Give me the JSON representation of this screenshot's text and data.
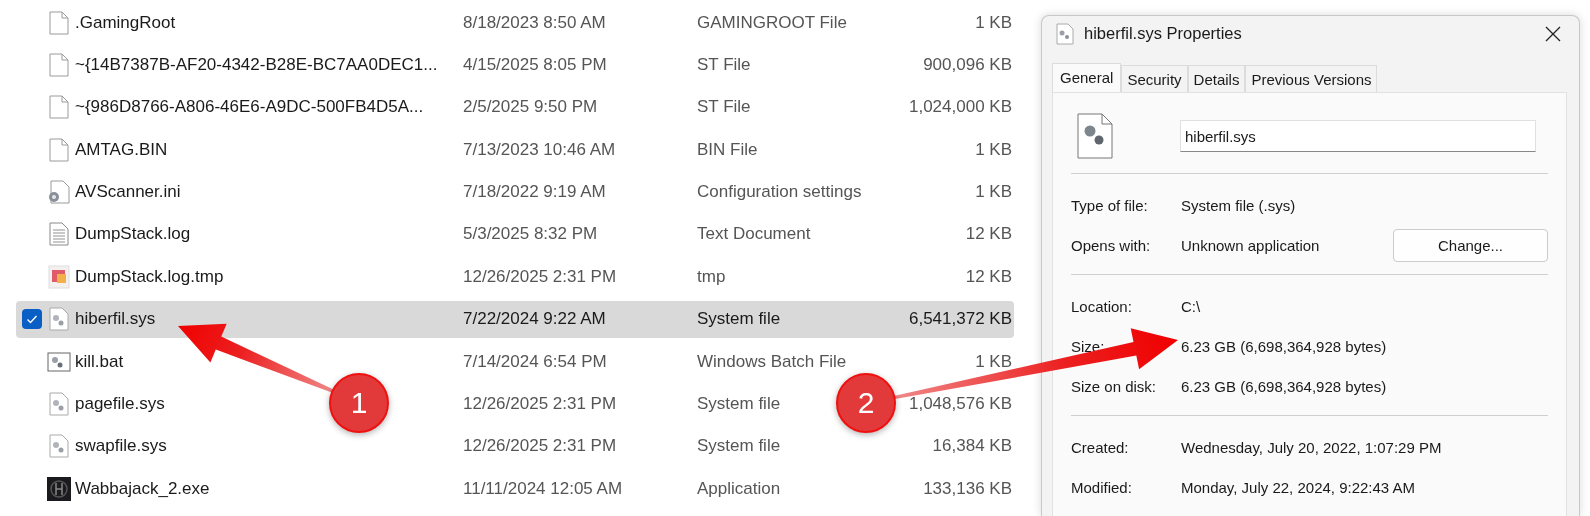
{
  "files": [
    {
      "name": ".GamingRoot",
      "modified": "8/18/2023 8:50 AM",
      "type": "GAMINGROOT File",
      "size": "1 KB",
      "kind": "blank",
      "selected": false
    },
    {
      "name": "~{14B7387B-AF20-4342-B28E-BC7AA0DEC1...",
      "modified": "4/15/2025 8:05 PM",
      "type": "ST File",
      "size": "900,096 KB",
      "kind": "blank",
      "selected": false
    },
    {
      "name": "~{986D8766-A806-46E6-A9DC-500FB4D5A...",
      "modified": "2/5/2025 9:50 PM",
      "type": "ST File",
      "size": "1,024,000 KB",
      "kind": "blank",
      "selected": false
    },
    {
      "name": "AMTAG.BIN",
      "modified": "7/13/2023 10:46 AM",
      "type": "BIN File",
      "size": "1 KB",
      "kind": "blank",
      "selected": false
    },
    {
      "name": "AVScanner.ini",
      "modified": "7/18/2022 9:19 AM",
      "type": "Configuration settings",
      "size": "1 KB",
      "kind": "config",
      "selected": false
    },
    {
      "name": "DumpStack.log",
      "modified": "5/3/2025 8:32 PM",
      "type": "Text Document",
      "size": "12 KB",
      "kind": "text",
      "selected": false
    },
    {
      "name": "DumpStack.log.tmp",
      "modified": "12/26/2025 2:31 PM",
      "type": "tmp",
      "size": "12 KB",
      "kind": "tmp",
      "selected": false
    },
    {
      "name": "hiberfil.sys",
      "modified": "7/22/2024 9:22 AM",
      "type": "System file",
      "size": "6,541,372 KB",
      "kind": "system",
      "selected": true
    },
    {
      "name": "kill.bat",
      "modified": "7/14/2024 6:54 PM",
      "type": "Windows Batch File",
      "size": "1 KB",
      "kind": "batch",
      "selected": false
    },
    {
      "name": "pagefile.sys",
      "modified": "12/26/2025 2:31 PM",
      "type": "System file",
      "size": "1,048,576 KB",
      "kind": "system",
      "selected": false
    },
    {
      "name": "swapfile.sys",
      "modified": "12/26/2025 2:31 PM",
      "type": "System file",
      "size": "16,384 KB",
      "kind": "system",
      "selected": false
    },
    {
      "name": "Wabbajack_2.exe",
      "modified": "11/11/2024 12:05 AM",
      "type": "Application",
      "size": "133,136 KB",
      "kind": "app",
      "selected": false
    }
  ],
  "dialog": {
    "title": "hiberfil.sys Properties",
    "tabs": [
      {
        "label": "General",
        "selected": true
      },
      {
        "label": "Security",
        "selected": false
      },
      {
        "label": "Details",
        "selected": false
      },
      {
        "label": "Previous Versions",
        "selected": false
      }
    ],
    "file_name": "hiberfil.sys",
    "sections": [
      [
        {
          "label": "Type of file:",
          "value": "System file (.sys)"
        },
        {
          "label": "Opens with:",
          "value": "Unknown application",
          "button": "Change..."
        }
      ],
      [
        {
          "label": "Location:",
          "value": "C:\\"
        },
        {
          "label": "Size:",
          "value": "6.23 GB (6,698,364,928 bytes)"
        },
        {
          "label": "Size on disk:",
          "value": "6.23 GB (6,698,364,928 bytes)"
        }
      ],
      [
        {
          "label": "Created:",
          "value": "Wednesday, July 20, 2022, 1:07:29 PM"
        },
        {
          "label": "Modified:",
          "value": "Monday, July 22, 2024, 9:22:43 AM"
        }
      ]
    ]
  },
  "annotations": [
    {
      "label": "1"
    },
    {
      "label": "2"
    }
  ]
}
